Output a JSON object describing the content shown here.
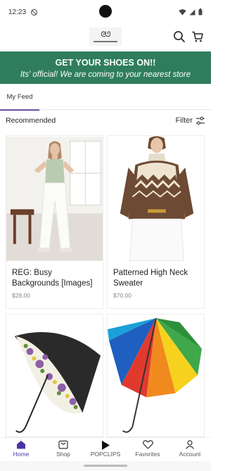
{
  "status": {
    "time": "12:23"
  },
  "header": {
    "logo_icon": "brand-logo-icon"
  },
  "banner": {
    "title": "GET YOUR SHOES ON!!",
    "subtitle": "Its' official! We are coming to your nearest store",
    "color": "#2f7d5c"
  },
  "tabs": {
    "feed": "My Feed",
    "accent": "#6b4ea3"
  },
  "section": {
    "title": "Recommended",
    "filter": "Filter"
  },
  "products": [
    {
      "title": "REG: Busy Backgrounds [Images]",
      "price": "$28.00",
      "image": "woman-white-pants-photo"
    },
    {
      "title": "Patterned High Neck Sweater",
      "price": "$70.00",
      "image": "patterned-sweater-photo"
    },
    {
      "title": "",
      "price": "",
      "image": "floral-umbrella-photo"
    },
    {
      "title": "",
      "price": "",
      "image": "rainbow-umbrella-photo"
    }
  ],
  "nav": {
    "home": "Home",
    "shop": "Shop",
    "popclips": "POPCLIPS",
    "favorites": "Favorites",
    "account": "Account",
    "active_color": "#4b33a8"
  }
}
